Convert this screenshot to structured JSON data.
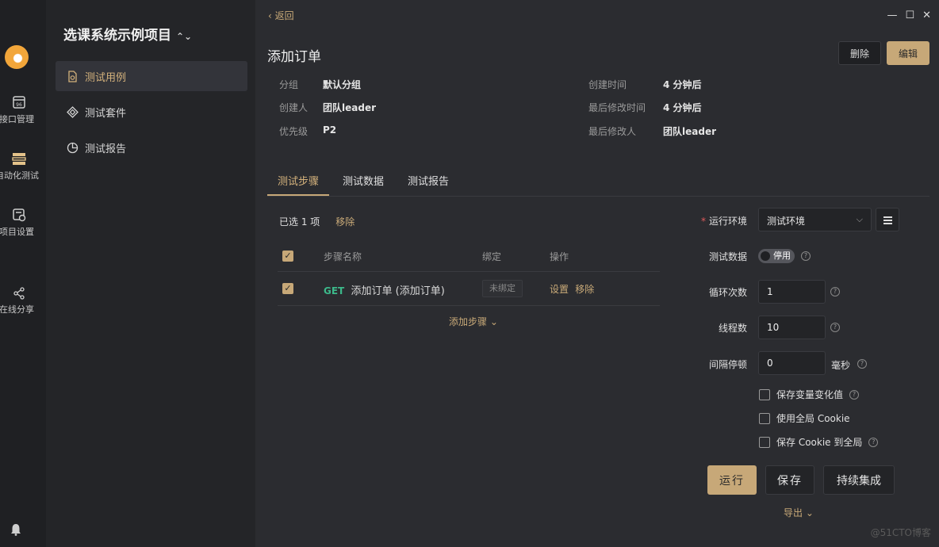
{
  "rail": {
    "items": [
      {
        "label": "接口管理"
      },
      {
        "label": "自动化测试"
      },
      {
        "label": "项目设置"
      },
      {
        "label": "在线分享"
      }
    ]
  },
  "sidebar": {
    "project_title": "选课系统示例项目",
    "items": [
      {
        "label": "测试用例"
      },
      {
        "label": "测试套件"
      },
      {
        "label": "测试报告"
      }
    ]
  },
  "header": {
    "back_label": "返回",
    "title": "添加订单",
    "delete_label": "删除",
    "edit_label": "编辑"
  },
  "meta": {
    "group_key": "分组",
    "group_val": "默认分组",
    "creator_key": "创建人",
    "creator_val": "团队leader",
    "priority_key": "优先级",
    "priority_val": "P2",
    "created_key": "创建时间",
    "created_val": "4 分钟后",
    "modified_key": "最后修改时间",
    "modified_val": "4 分钟后",
    "modifier_key": "最后修改人",
    "modifier_val": "团队leader"
  },
  "tabs": [
    "测试步骤",
    "测试数据",
    "测试报告"
  ],
  "steps": {
    "selected_text": "已选 1 项",
    "remove_label": "移除",
    "columns": {
      "name": "步骤名称",
      "bind": "绑定",
      "ops": "操作"
    },
    "rows": [
      {
        "method": "GET",
        "name": "添加订单 (添加订单)",
        "bind": "未绑定",
        "op_set": "设置",
        "op_remove": "移除"
      }
    ],
    "add_label": "添加步骤"
  },
  "config": {
    "env_label": "运行环境",
    "env_value": "测试环境",
    "data_label": "测试数据",
    "data_toggle": "停用",
    "loop_label": "循环次数",
    "loop_value": "1",
    "thread_label": "线程数",
    "thread_value": "10",
    "interval_label": "间隔停顿",
    "interval_value": "0",
    "interval_unit": "毫秒",
    "checks": [
      "保存变量变化值",
      "使用全局 Cookie",
      "保存 Cookie 到全局"
    ],
    "run_label": "运行",
    "save_label": "保存",
    "ci_label": "持续集成",
    "export_label": "导出"
  },
  "watermark": "@51CTO博客",
  "colors": {
    "accent": "#c7a878",
    "get": "#3cb88a",
    "bg": "#2b2c30"
  }
}
